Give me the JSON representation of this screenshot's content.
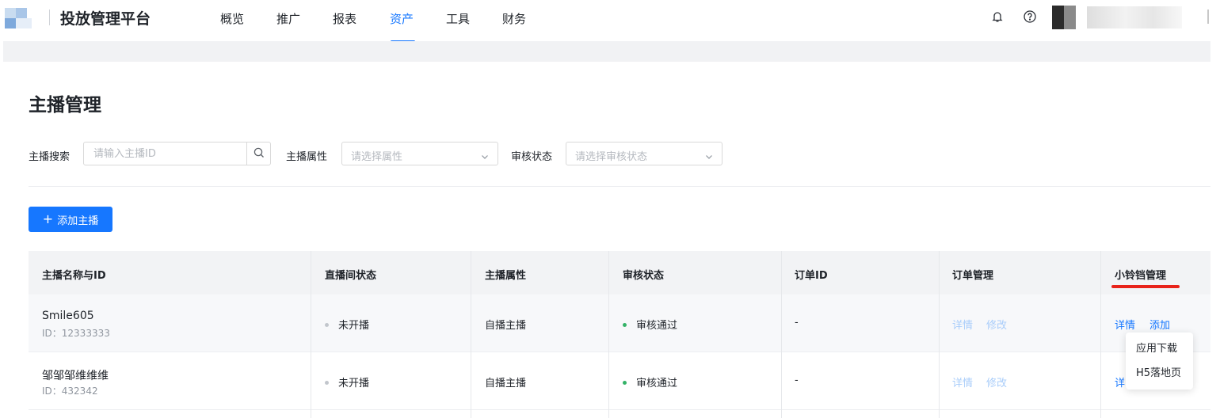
{
  "header": {
    "brand": "投放管理平台",
    "nav": [
      {
        "label": "概览",
        "active": false
      },
      {
        "label": "推广",
        "active": false
      },
      {
        "label": "报表",
        "active": false
      },
      {
        "label": "资产",
        "active": true
      },
      {
        "label": "工具",
        "active": false
      },
      {
        "label": "财务",
        "active": false
      }
    ],
    "icons": [
      "bell-icon",
      "help-icon"
    ],
    "accent_color": "#1677ff"
  },
  "page": {
    "title": "主播管理"
  },
  "filters": {
    "search_label": "主播搜索",
    "search_placeholder": "请输入主播ID",
    "attr_label": "主播属性",
    "attr_placeholder": "请选择属性",
    "review_label": "审核状态",
    "review_placeholder": "请选择审核状态"
  },
  "actions": {
    "add_label": "添加主播"
  },
  "table": {
    "headers": [
      "主播名称与ID",
      "直播间状态",
      "主播属性",
      "审核状态",
      "订单ID",
      "订单管理",
      "小铃铛管理"
    ],
    "rows": [
      {
        "name": "Smile605",
        "id": "ID：12333333",
        "live_status": "未开播",
        "attr": "自播主播",
        "review": "审核通过",
        "order_id": "-",
        "order_actions": [
          "详情",
          "修改"
        ],
        "bell_actions": [
          "详情",
          "添加"
        ]
      },
      {
        "name": "邹邹邹维维维",
        "id": "ID：432342",
        "live_status": "未开播",
        "attr": "自播主播",
        "review": "审核通过",
        "order_id": "-",
        "order_actions": [
          "详情",
          "修改"
        ],
        "bell_actions": [
          "详"
        ]
      }
    ]
  },
  "dropdown": {
    "items": [
      "应用下载",
      "H5落地页"
    ]
  },
  "colors": {
    "link_disabled": "#a9cdfa",
    "status_ok": "#34b267",
    "status_idle": "#c2c6cc",
    "annotation": "#e8231a"
  }
}
